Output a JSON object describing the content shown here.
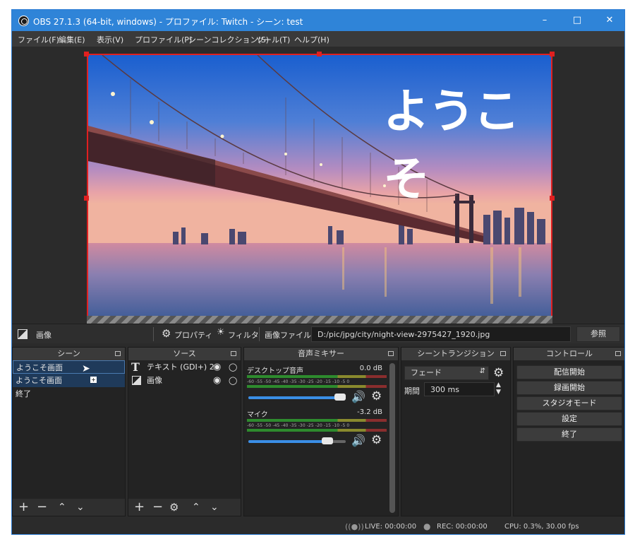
{
  "window": {
    "title": "OBS 27.1.3 (64-bit, windows) - プロファイル: Twitch - シーン: test"
  },
  "menu": [
    "ファイル(F)",
    "編集(E)",
    "表示(V)",
    "プロファイル(P)",
    "シーンコレクション(S)",
    "ツール(T)",
    "ヘルプ(H)"
  ],
  "preview": {
    "overlay_text": "ようこそ"
  },
  "source_bar": {
    "selected_name": "画像",
    "properties_label": "プロパティ",
    "filters_label": "フィルタ",
    "file_label": "画像ファイル",
    "file_path": "D:/pic/jpg/city/night-view-2975427_1920.jpg",
    "browse_label": "参照"
  },
  "scenes": {
    "header": "シーン",
    "items": [
      "ようこそ画面",
      "ようこそ画面",
      "終了"
    ]
  },
  "sources": {
    "header": "ソース",
    "items": [
      "テキスト (GDI+) 2",
      "画像"
    ]
  },
  "mixer": {
    "header": "音声ミキサー",
    "channels": [
      {
        "name": "デスクトップ音声",
        "db": "0.0 dB",
        "volume": 0.9
      },
      {
        "name": "マイク",
        "db": "-3.2 dB",
        "volume": 0.8
      }
    ],
    "scale": "-60 -55 -50 -45 -40 -35 -30 -25 -20 -15 -10 -5 0"
  },
  "transitions": {
    "header": "シーントランジション",
    "selected": "フェード",
    "duration_label": "期間",
    "duration_value": "300 ms"
  },
  "controls": {
    "header": "コントロール",
    "buttons": [
      "配信開始",
      "録画開始",
      "スタジオモード",
      "設定",
      "終了"
    ]
  },
  "status": {
    "live": "LIVE: 00:00:00",
    "rec": "REC: 00:00:00",
    "cpu": "CPU: 0.3%, 30.00 fps"
  },
  "colors": {
    "titlebar": "#2f84d8",
    "selection": "#e02020",
    "accent": "#3a8ee6"
  }
}
